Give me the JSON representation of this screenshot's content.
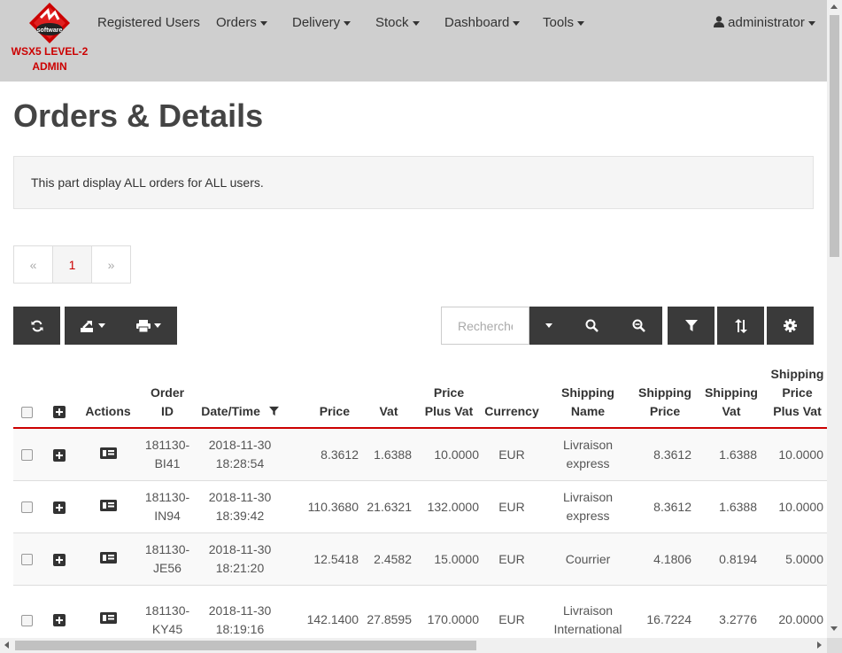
{
  "brand": {
    "logo_text": "software",
    "line1": "WSX5 LEVEL-2",
    "line2": "ADMIN"
  },
  "nav": {
    "registered_users": "Registered Users",
    "orders": "Orders",
    "delivery": "Delivery",
    "stock": "Stock",
    "dashboard": "Dashboard",
    "tools": "Tools",
    "user": "administrator"
  },
  "page": {
    "title": "Orders & Details",
    "info": "This part display ALL orders for ALL users."
  },
  "pagination": {
    "prev": "«",
    "current": "1",
    "next": "»"
  },
  "toolbar": {
    "search_placeholder": "Recherche",
    "icons": [
      "refresh-icon",
      "export-icon",
      "print-icon",
      "search-icon",
      "zoom-out-icon",
      "filter-icon",
      "sort-icon",
      "settings-icon"
    ]
  },
  "table": {
    "headers": {
      "actions": "Actions",
      "order_id": [
        "Order",
        "ID"
      ],
      "datetime": "Date/Time",
      "price": "Price",
      "vat": "Vat",
      "price_plus_vat": [
        "Price",
        "Plus Vat"
      ],
      "currency": "Currency",
      "shipping_name": [
        "Shipping",
        "Name"
      ],
      "shipping_price": [
        "Shipping",
        "Price"
      ],
      "shipping_vat": [
        "Shipping",
        "Vat"
      ],
      "shipping_price_plus_vat": [
        "Shipping",
        "Price",
        "Plus Vat"
      ]
    },
    "rows": [
      {
        "order_id": [
          "181130-",
          "BI41"
        ],
        "datetime": [
          "2018-11-30",
          "18:28:54"
        ],
        "price": "8.3612",
        "vat": "1.6388",
        "price_plus_vat": "10.0000",
        "currency": "EUR",
        "shipping_name": [
          "Livraison",
          "express"
        ],
        "shipping_price": "8.3612",
        "shipping_vat": "1.6388",
        "shipping_price_plus_vat": "10.0000"
      },
      {
        "order_id": [
          "181130-",
          "IN94"
        ],
        "datetime": [
          "2018-11-30",
          "18:39:42"
        ],
        "price": "110.3680",
        "vat": "21.6321",
        "price_plus_vat": "132.0000",
        "currency": "EUR",
        "shipping_name": [
          "Livraison",
          "express"
        ],
        "shipping_price": "8.3612",
        "shipping_vat": "1.6388",
        "shipping_price_plus_vat": "10.0000"
      },
      {
        "order_id": [
          "181130-",
          "JE56"
        ],
        "datetime": [
          "2018-11-30",
          "18:21:20"
        ],
        "price": "12.5418",
        "vat": "2.4582",
        "price_plus_vat": "15.0000",
        "currency": "EUR",
        "shipping_name": [
          "Courrier",
          ""
        ],
        "shipping_price": "4.1806",
        "shipping_vat": "0.8194",
        "shipping_price_plus_vat": "5.0000"
      },
      {
        "order_id": [
          "181130-",
          "KY45"
        ],
        "datetime": [
          "2018-11-30",
          "18:19:16"
        ],
        "price": "142.1400",
        "vat": "27.8595",
        "price_plus_vat": "170.0000",
        "currency": "EUR",
        "shipping_name": [
          "Livraison",
          "International"
        ],
        "shipping_price": "16.7224",
        "shipping_vat": "3.2776",
        "shipping_price_plus_vat": "20.0000"
      }
    ]
  },
  "colors": {
    "navbar": "#cfcfcf",
    "accent": "#cc0000",
    "toolbar_button": "#3a3a3a"
  }
}
